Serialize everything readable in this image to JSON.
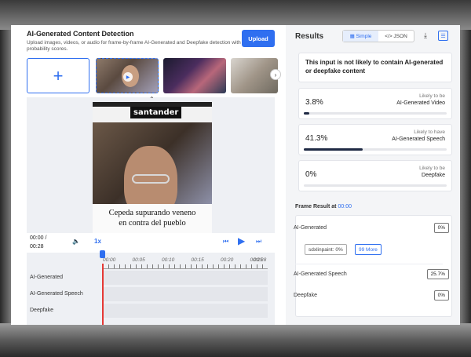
{
  "left": {
    "title": "AI-Generated Content Detection",
    "description": "Upload images, videos, or audio for frame-by-frame AI-Generated and Deepfake detection with probability scores.",
    "upload_label": "Upload",
    "add_icon": "plus-icon",
    "next_icon": "chevron-right-icon"
  },
  "video": {
    "brand_text": "santander",
    "caption_line1": "Cepeda supurando veneno",
    "caption_line2": "en contra del pueblo"
  },
  "player": {
    "current_time": "00:00 /",
    "total_time": "00:28",
    "speed": "1x",
    "volume_icon": "volume-icon",
    "prev_icon": "skip-back-icon",
    "play_icon": "play-icon",
    "next_icon": "skip-forward-icon"
  },
  "timeline": {
    "ticks": [
      "00:00",
      "00:05",
      "00:10",
      "00:15",
      "00:20",
      "00:25",
      "00:28"
    ],
    "tracks": [
      "AI-Generated",
      "AI-Generated Speech",
      "Deepfake"
    ],
    "playhead_fraction": 0
  },
  "results": {
    "title": "Results",
    "toggle_simple": "Simple",
    "toggle_json": "</> JSON",
    "download_icon": "download-icon",
    "filter_icon": "filter-icon",
    "verdict": "This input is not likely to contain AI-generated or deepfake content",
    "scores": [
      {
        "pct": "3.8%",
        "value": 3.8,
        "line1": "Likely to be",
        "line2": "AI-Generated Video"
      },
      {
        "pct": "41.3%",
        "value": 41.3,
        "line1": "Likely to have",
        "line2": "AI-Generated Speech"
      },
      {
        "pct": "0%",
        "value": 0,
        "line1": "Likely to be",
        "line2": "Deepfake"
      }
    ],
    "frame_header": "Frame Result at",
    "frame_time": "00:00",
    "frame_rows": [
      {
        "label": "AI-Generated",
        "value": "0%"
      },
      {
        "label": "AI-Generated Speech",
        "value": "25.7%"
      },
      {
        "label": "Deepfake",
        "value": "0%"
      }
    ],
    "chip_model": "sdxlinpaint: 0%",
    "chip_more": "99 More"
  },
  "colors": {
    "accent": "#2f6ff0",
    "bar": "#1f2a44",
    "playhead": "#e53935"
  }
}
